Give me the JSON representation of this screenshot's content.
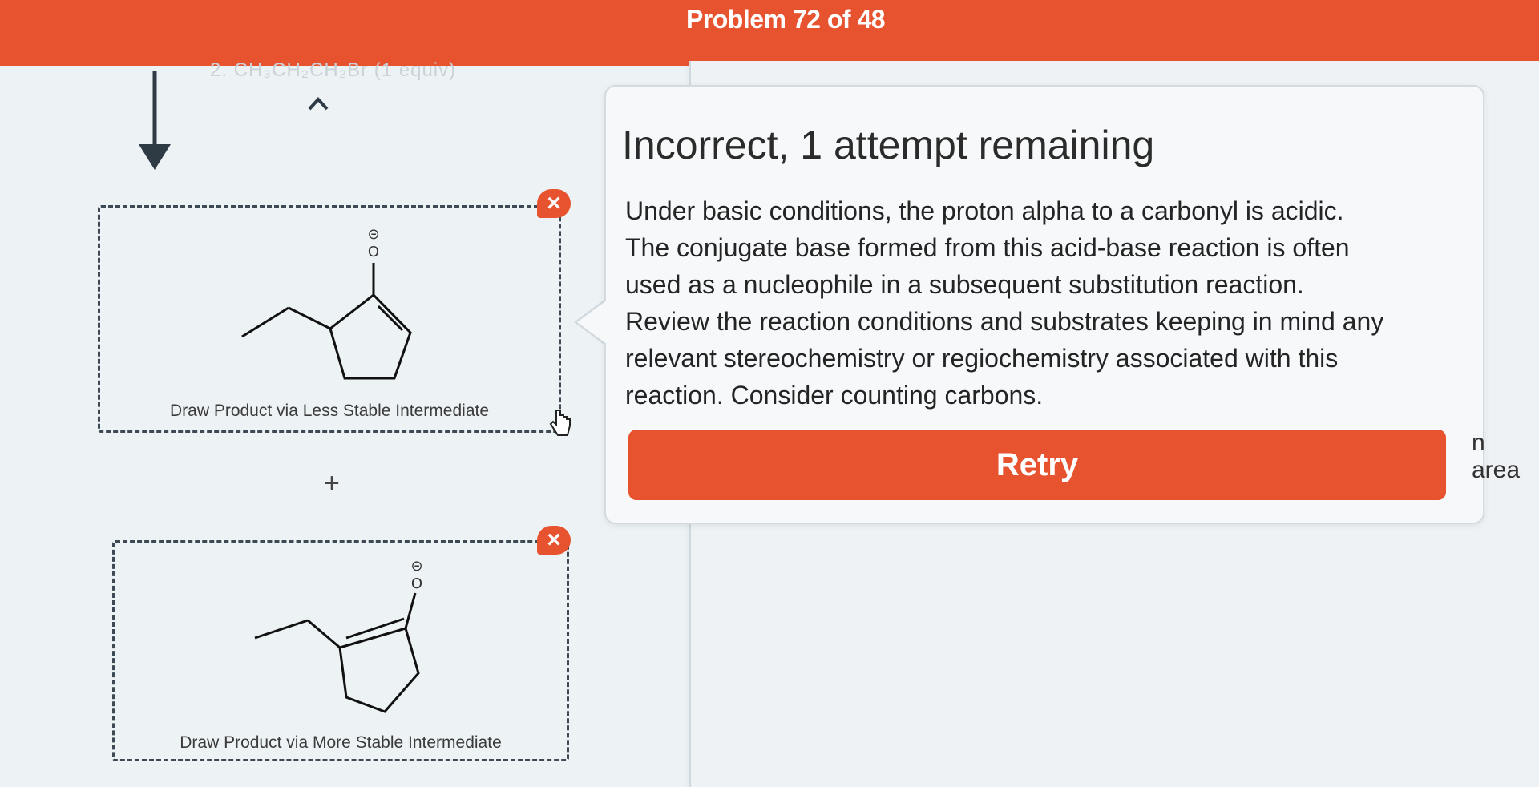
{
  "header": {
    "title": "Problem 72 of 48"
  },
  "reaction": {
    "reagent_faded": "2. CH₃CH₂CH₂Br (1 equiv)"
  },
  "draw_boxes": [
    {
      "label": "Draw Product via Less Stable Intermediate",
      "atom_o": "O",
      "charge": "⊝"
    },
    {
      "label": "Draw Product via More Stable Intermediate",
      "atom_o": "O",
      "charge": "⊝"
    }
  ],
  "plus_sign": "+",
  "feedback": {
    "title": "Incorrect, 1 attempt remaining",
    "lines": [
      "Under basic conditions, the proton alpha to a carbonyl is acidic.",
      "The conjugate base formed from this acid-base reaction is often",
      "used as a nucleophile in a subsequent substitution reaction.",
      "Review the reaction conditions and substrates keeping in mind any",
      "relevant stereochemistry or regiochemistry associated with this",
      "reaction. Consider counting carbons."
    ],
    "retry_label": "Retry"
  },
  "side_text": "n area",
  "icons": [
    "down-arrow-icon",
    "caret-up-icon",
    "close-x-icon",
    "hand-cursor-icon"
  ],
  "colors": {
    "accent": "#e8532f",
    "panel": "#f6f8f9",
    "background": "#e8eef1"
  }
}
